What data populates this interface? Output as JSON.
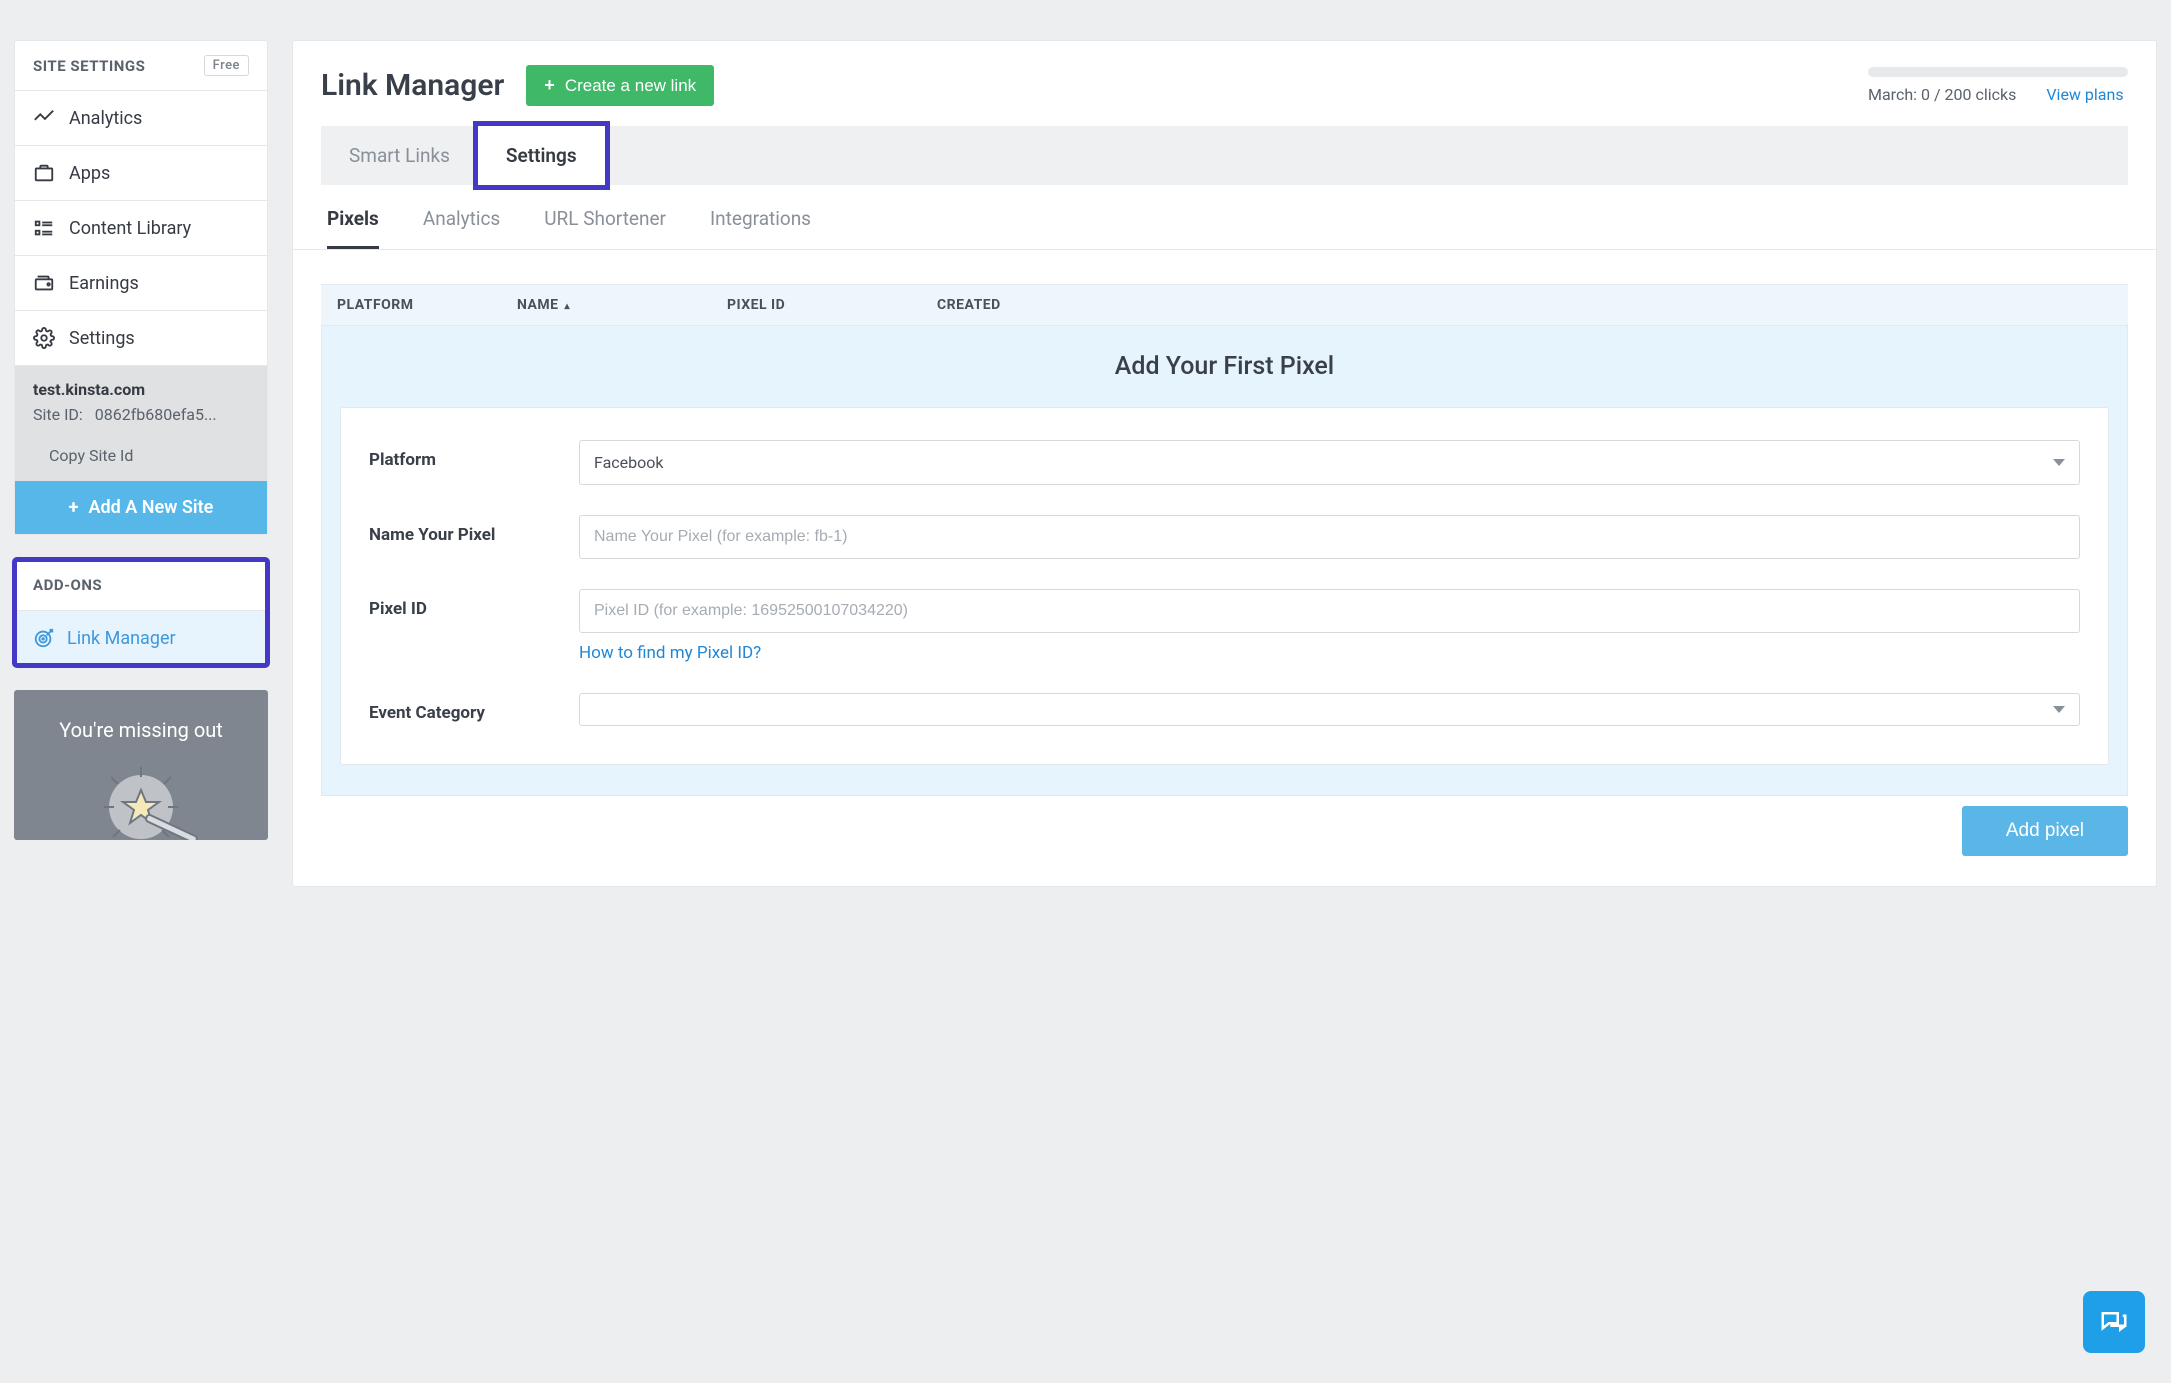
{
  "sidebar": {
    "settings_header": "SITE SETTINGS",
    "plan_badge": "Free",
    "nav": [
      {
        "label": "Analytics",
        "icon": "analytics-icon"
      },
      {
        "label": "Apps",
        "icon": "apps-icon"
      },
      {
        "label": "Content Library",
        "icon": "content-library-icon"
      },
      {
        "label": "Earnings",
        "icon": "earnings-icon"
      },
      {
        "label": "Settings",
        "icon": "settings-icon"
      }
    ],
    "site": {
      "domain": "test.kinsta.com",
      "site_id_label": "Site ID:",
      "site_id_value": "0862fb680efa5...",
      "copy_label": "Copy Site Id"
    },
    "add_site_label": "Add A New Site",
    "addons_header": "ADD-ONS",
    "addons": [
      {
        "label": "Link Manager",
        "icon": "target-icon",
        "active": true
      }
    ],
    "promo_title": "You're missing out"
  },
  "header": {
    "title": "Link Manager",
    "create_button": "Create a new link",
    "usage_text": "March: 0 / 200 clicks",
    "view_plans": "View plans"
  },
  "tabs_primary": [
    {
      "label": "Smart Links",
      "active": false
    },
    {
      "label": "Settings",
      "active": true,
      "highlighted": true
    }
  ],
  "tabs_secondary": [
    {
      "label": "Pixels",
      "active": true
    },
    {
      "label": "Analytics",
      "active": false
    },
    {
      "label": "URL Shortener",
      "active": false
    },
    {
      "label": "Integrations",
      "active": false
    }
  ],
  "table": {
    "columns": {
      "platform": "PLATFORM",
      "name": "NAME",
      "pixel_id": "PIXEL ID",
      "created": "CREATED"
    }
  },
  "pixel_form": {
    "title": "Add Your First Pixel",
    "platform_label": "Platform",
    "platform_value": "Facebook",
    "name_label": "Name Your Pixel",
    "name_placeholder": "Name Your Pixel (for example: fb-1)",
    "pixel_id_label": "Pixel ID",
    "pixel_id_placeholder": "Pixel ID (for example: 16952500107034220)",
    "help_link": "How to find my Pixel ID?",
    "event_category_label": "Event Category",
    "submit_label": "Add pixel"
  }
}
